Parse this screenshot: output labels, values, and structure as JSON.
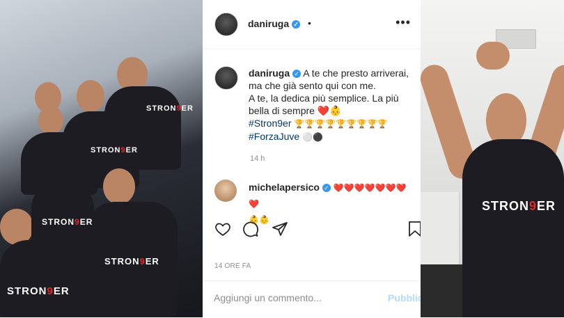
{
  "post": {
    "header": {
      "username": "daniruga",
      "verified_mark": "✓",
      "separator": "•",
      "more_icon": "•••"
    },
    "caption": {
      "username": "daniruga",
      "line1": "A te che presto arriverai,",
      "line2": "ma che già sento qui con me.",
      "line3": "A te, la dedica più semplice. La più",
      "line4_text": "bella di sempre",
      "line4_emoji": "❤️👶",
      "hashtag1": "#Stron9er",
      "hashtag1_emoji": "🏆🏆🏆🏆🏆🏆🏆🏆🏆",
      "hashtag2": "#ForzaJuve",
      "hashtag2_emoji": "⚪⚫",
      "time": "14 h"
    },
    "comment": {
      "username": "michelapersico",
      "hearts": "❤️❤️❤️❤️❤️❤️❤️❤️",
      "babies": "👶👶"
    },
    "date_label": "14 ORE FA",
    "comment_placeholder": "Aggiungi un commento...",
    "publish_label": "Pubblica"
  },
  "photos": {
    "left_shirt_text_a": "STRON",
    "left_shirt_nine": "9",
    "left_shirt_text_b": "ER",
    "right_shirt_text_a": "STRON",
    "right_shirt_nine": "9",
    "right_shirt_text_b": "ER"
  },
  "colors": {
    "text_primary": "#262626",
    "text_secondary": "#8e8e8e",
    "hashtag": "#00376b",
    "verified": "#3897f0",
    "publish_disabled": "#b3dbff",
    "juve_red": "#e02828"
  },
  "icons": [
    "more-options-icon",
    "heart-icon",
    "comment-icon",
    "share-icon",
    "bookmark-icon",
    "verified-badge-icon"
  ]
}
